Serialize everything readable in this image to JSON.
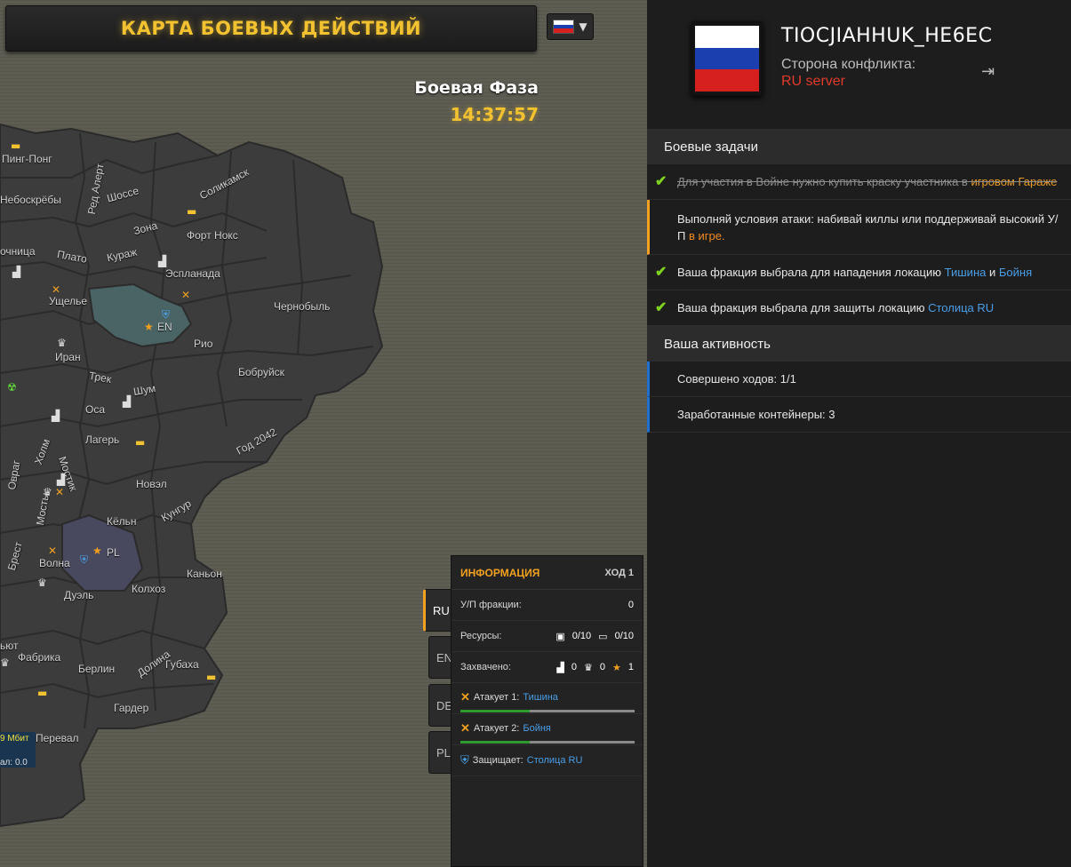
{
  "header": {
    "title": "КАРТА БОЕВЫХ ДЕЙСТВИЙ",
    "phase_title": "Боевая Фаза",
    "phase_time": "14:37:57"
  },
  "map": {
    "regions": [
      {
        "name": "Пинг-Понг"
      },
      {
        "name": "Небоскрёбы"
      },
      {
        "name": "Ред Алерт"
      },
      {
        "name": "Шоссе"
      },
      {
        "name": "Соликамск"
      },
      {
        "name": "Зона"
      },
      {
        "name": "Форт Нокс"
      },
      {
        "name": "Кураж"
      },
      {
        "name": "Плато"
      },
      {
        "name": "Эспланада"
      },
      {
        "name": "Ущелье"
      },
      {
        "name": "Чернобыль"
      },
      {
        "name": "EN"
      },
      {
        "name": "Иран"
      },
      {
        "name": "Рио"
      },
      {
        "name": "Трек"
      },
      {
        "name": "Шум"
      },
      {
        "name": "Бобруйск"
      },
      {
        "name": "Оса"
      },
      {
        "name": "Лагерь"
      },
      {
        "name": "Год 2042"
      },
      {
        "name": "Холм"
      },
      {
        "name": "Мостик"
      },
      {
        "name": "Овраг"
      },
      {
        "name": "Новэл"
      },
      {
        "name": "Мосты"
      },
      {
        "name": "Кёльн"
      },
      {
        "name": "Кунгур"
      },
      {
        "name": "Брест"
      },
      {
        "name": "PL"
      },
      {
        "name": "Волна"
      },
      {
        "name": "Каньон"
      },
      {
        "name": "Колхоз"
      },
      {
        "name": "Дуэль"
      },
      {
        "name": "Долина"
      },
      {
        "name": "Фабрика"
      },
      {
        "name": "Берлин"
      },
      {
        "name": "Губаха"
      },
      {
        "name": "Гардер"
      },
      {
        "name": "Перевал"
      },
      {
        "name": "ьют"
      },
      {
        "name": "очница"
      }
    ],
    "net_badge": {
      "speed": "9 Мбит",
      "sub": "ал: 0.0"
    }
  },
  "factions": {
    "tabs": [
      {
        "label": "RU",
        "active": true
      },
      {
        "label": "EN",
        "active": false
      },
      {
        "label": "DE",
        "active": false
      },
      {
        "label": "PL",
        "active": false
      }
    ]
  },
  "info_panel": {
    "title": "ИНФОРМАЦИЯ",
    "turn": "ХОД 1",
    "up_label": "У/П фракции:",
    "up_value": "0",
    "resources_label": "Ресурсы:",
    "res1": "0/10",
    "res2": "0/10",
    "captured_label": "Захвачено:",
    "cap1": "0",
    "cap2": "0",
    "cap3": "1",
    "attack1_label": "Атакует 1:",
    "attack1_target": "Тишина",
    "attack1_progress": 0.4,
    "attack2_label": "Атакует 2:",
    "attack2_target": "Бойня",
    "attack2_progress": 0.4,
    "defend_label": "Защищает:",
    "defend_target": "Столица RU"
  },
  "profile": {
    "username": "TIOCJIAHHUK_HE6EC",
    "side_label": "Сторона конфликта:",
    "server": "RU server"
  },
  "tasks": {
    "section_title": "Боевые задачи",
    "task1_text": "Для участия в Войне нужно купить краску участника в",
    "task1_link": "игровом Гараже",
    "task2_text": "Выполняй условия атаки: набивай киллы или поддерживай высокий У/П",
    "task2_link": "в игре.",
    "task3_text": "Ваша фракция выбрала для нападения локацию",
    "task3_link1": "Тишина",
    "task3_and": "и",
    "task3_link2": "Бойня",
    "task4_text": "Ваша фракция выбрала для защиты локацию",
    "task4_link": "Столица RU"
  },
  "activity": {
    "section_title": "Ваша активность",
    "turns": "Совершено ходов: 1/1",
    "containers": "Заработанные контейнеры: 3"
  },
  "colors": {
    "accent": "#f2c230",
    "link_blue": "#4a9ee8",
    "server_red": "#e03a2a",
    "check_green": "#7ed321"
  }
}
